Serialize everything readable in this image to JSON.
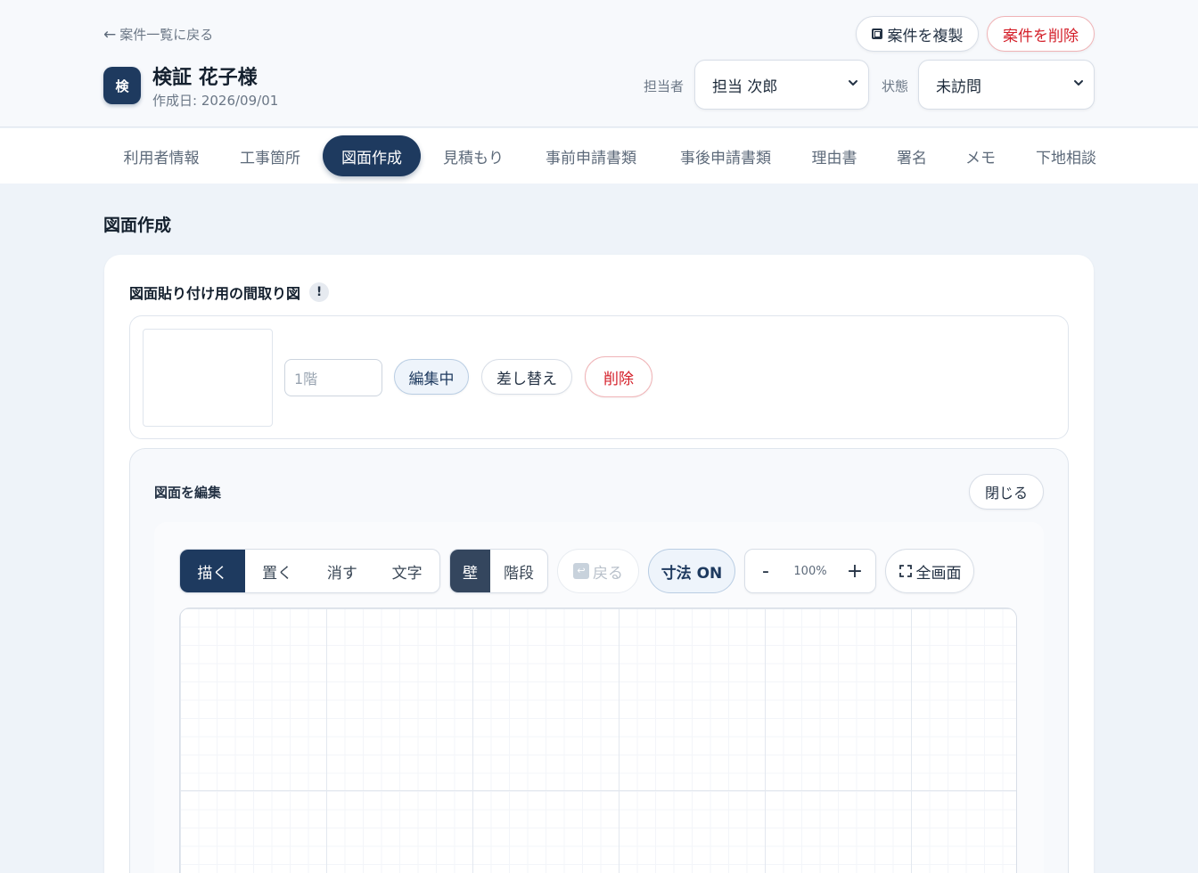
{
  "header": {
    "back_label": "案件一覧に戻る",
    "avatar_initial": "検",
    "case_name": "検証 花子様",
    "created": "作成日: 2026/09/01",
    "duplicate_label": "案件を複製",
    "delete_label": "案件を削除",
    "staff_label": "担当者",
    "staff_value": "担当 次郎",
    "status_label": "状態",
    "status_value": "未訪問"
  },
  "tabs": [
    {
      "label": "利用者情報"
    },
    {
      "label": "工事箇所"
    },
    {
      "label": "図面作成",
      "active": true
    },
    {
      "label": "見積もり"
    },
    {
      "label": "事前申請書類"
    },
    {
      "label": "事後申請書類"
    },
    {
      "label": "理由書"
    },
    {
      "label": "署名"
    },
    {
      "label": "メモ"
    },
    {
      "label": "下地相談"
    }
  ],
  "main": {
    "section_title": "図面作成",
    "card_title": "図面貼り付け用の間取り図",
    "info_mark": "!",
    "floor": {
      "placeholder": "1階",
      "editing_label": "編集中",
      "replace_label": "差し替え",
      "delete_label": "削除"
    },
    "editor": {
      "title": "図面を編集",
      "close_label": "閉じる",
      "modes": [
        "描く",
        "置く",
        "消す",
        "文字"
      ],
      "active_mode": "描く",
      "types": [
        "壁",
        "階段"
      ],
      "active_type": "壁",
      "undo_label": "戻る",
      "dimension_label": "寸法 ON",
      "zoom_minus": "-",
      "zoom_value": "100%",
      "zoom_plus": "+",
      "fullscreen_label": "全画面"
    }
  },
  "colors": {
    "primary": "#1e3a5f",
    "danger": "#d4202a",
    "background": "#eef3f9"
  }
}
